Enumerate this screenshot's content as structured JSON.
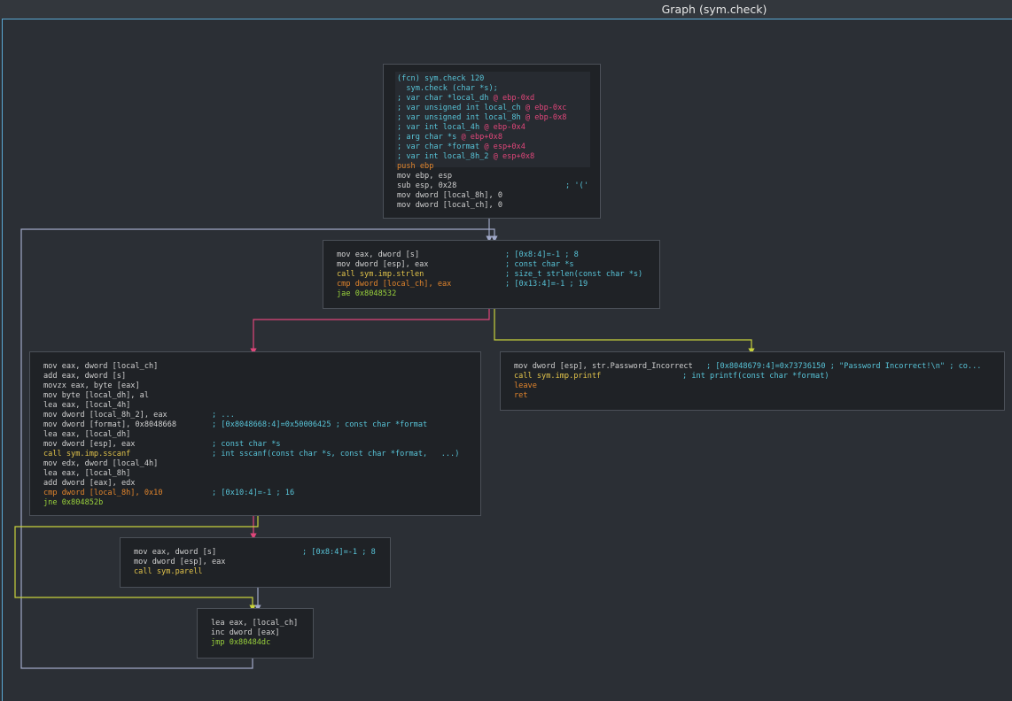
{
  "window": {
    "title": "Graph (sym.check)"
  },
  "colors": {
    "border_accent": "#5aa9d6",
    "edge_true": "#9ad23c",
    "edge_false": "#e0467a",
    "edge_plain": "#a0a8c8"
  },
  "nodes": {
    "n1": {
      "header": [
        "(fcn) sym.check 120",
        "  sym.check (char *s);",
        "; var char *local_dh @ ebp-0xd",
        "; var unsigned int local_ch @ ebp-0xc",
        "; var unsigned int local_8h @ ebp-0x8",
        "; var int local_4h @ ebp-0x4",
        "; arg char *s @ ebp+0x8",
        "; var char *format @ esp+0x4",
        "; var int local_8h_2 @ esp+0x8"
      ],
      "lines": [
        "push ebp",
        "mov ebp, esp",
        "sub esp, 0x28",
        "mov dword [local_8h], 0",
        "mov dword [local_ch], 0"
      ],
      "comments": [
        "; '('"
      ]
    },
    "n2": {
      "lines": [
        "mov eax, dword [s]",
        "mov dword [esp], eax",
        "call sym.imp.strlen",
        "cmp dword [local_ch], eax",
        "jae 0x8048532"
      ],
      "comments": [
        "; [0x8:4]=-1 ; 8",
        "; const char *s",
        "; size_t strlen(const char *s)",
        "; [0x13:4]=-1 ; 19"
      ]
    },
    "n3": {
      "lines": [
        "mov eax, dword [local_ch]",
        "add eax, dword [s]",
        "movzx eax, byte [eax]",
        "mov byte [local_dh], al",
        "lea eax, [local_4h]",
        "mov dword [local_8h_2], eax",
        "mov dword [format], 0x8048668",
        "lea eax, [local_dh]",
        "mov dword [esp], eax",
        "call sym.imp.sscanf",
        "mov edx, dword [local_4h]",
        "lea eax, [local_8h]",
        "add dword [eax], edx",
        "cmp dword [local_8h], 0x10",
        "jne 0x804852b"
      ],
      "comments": [
        "; ...",
        "; [0x8048668:4]=0x50006425 ; const char *format",
        "; const char *s",
        "; int sscanf(const char *s, const char *format,   ...)",
        "; [0x10:4]=-1 ; 16"
      ]
    },
    "n4": {
      "lines": [
        "mov dword [esp], str.Password_Incorrect",
        "call sym.imp.printf",
        "leave",
        "ret"
      ],
      "comments": [
        "; [0x8048679:4]=0x73736150 ; \"Password Incorrect!\\n\" ; co...",
        "; int printf(const char *format)"
      ]
    },
    "n5": {
      "lines": [
        "mov eax, dword [s]",
        "mov dword [esp], eax",
        "call sym.parell"
      ],
      "comments": [
        "; [0x8:4]=-1 ; 8"
      ]
    },
    "n6": {
      "lines": [
        "lea eax, [local_ch]",
        "inc dword [eax]",
        "jmp 0x80484dc"
      ]
    }
  }
}
